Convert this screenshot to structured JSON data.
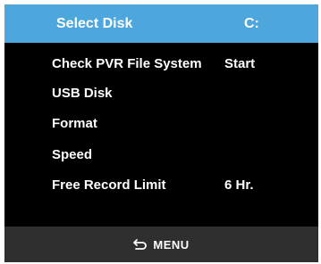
{
  "header": {
    "label": "Select Disk",
    "value": "C:"
  },
  "menu": {
    "items": [
      {
        "label": "Check PVR File System",
        "value": "Start"
      },
      {
        "label": "USB Disk",
        "value": ""
      },
      {
        "label": "Format",
        "value": ""
      },
      {
        "label": "Speed",
        "value": ""
      },
      {
        "label": "Free Record Limit",
        "value": "6 Hr."
      }
    ]
  },
  "footer": {
    "icon": "back-arrow-icon",
    "label": "MENU"
  },
  "colors": {
    "header_bg": "#4ea7dc",
    "screen_bg": "#000000",
    "footer_bg": "#2f2f2f",
    "text": "#ffffff"
  }
}
